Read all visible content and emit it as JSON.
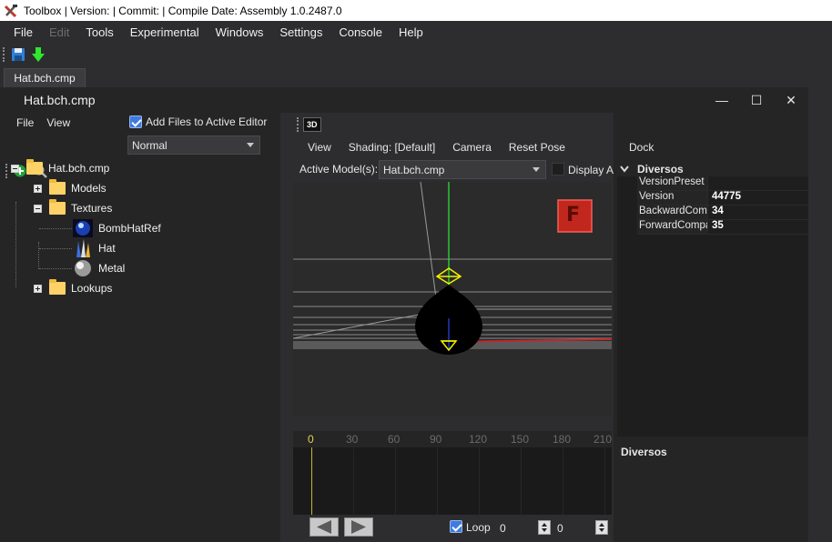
{
  "window": {
    "title": "Toolbox | Version:  | Commit:  | Compile Date:  Assembly 1.0.2487.0"
  },
  "menubar": {
    "items": [
      {
        "label": "File",
        "enabled": true
      },
      {
        "label": "Edit",
        "enabled": false
      },
      {
        "label": "Tools",
        "enabled": true
      },
      {
        "label": "Experimental",
        "enabled": true
      },
      {
        "label": "Windows",
        "enabled": true
      },
      {
        "label": "Settings",
        "enabled": true
      },
      {
        "label": "Console",
        "enabled": true
      },
      {
        "label": "Help",
        "enabled": true
      }
    ]
  },
  "toolbar": {
    "icons": [
      "save-icon",
      "download-icon"
    ]
  },
  "doc_tabs": [
    {
      "label": "Hat.bch.cmp",
      "active": true
    }
  ],
  "editor": {
    "title": "Hat.bch.cmp",
    "controls": {
      "minimize": "—",
      "maximize": "☐",
      "close": "✕"
    }
  },
  "left_panel": {
    "menu": [
      "File",
      "View"
    ],
    "add_files_label": "Add Files to Active Editor",
    "add_files_checked": true,
    "mode_select": "Normal",
    "tree": {
      "root": "Hat.bch.cmp",
      "models": "Models",
      "textures": "Textures",
      "texture_items": [
        "BombHatRef",
        "Hat",
        "Metal"
      ],
      "lookups": "Lookups"
    }
  },
  "viewport": {
    "badge": "3D",
    "menu": [
      "View",
      "Shading: [Default]",
      "Camera",
      "Reset Pose"
    ],
    "active_model_label": "Active Model(s):",
    "active_model_value": "Hat.bch.cmp",
    "display_all_label": "Display Al",
    "overlay_letter": "F",
    "timeline_ticks": [
      "0",
      "30",
      "60",
      "90",
      "120",
      "150",
      "180",
      "210"
    ],
    "loop_label": "Loop",
    "loop_checked": true,
    "frame_value": "0",
    "frame_end_value": "0"
  },
  "dock": {
    "title": "Dock",
    "category": "Diversos",
    "properties": [
      {
        "name": "VersionPreset",
        "value": ""
      },
      {
        "name": "Version",
        "value": "44775"
      },
      {
        "name": "BackwardCompa",
        "value": "34"
      },
      {
        "name": "ForwardCompati",
        "value": "35"
      }
    ],
    "description_title": "Diversos"
  },
  "colors": {
    "accent": "#3d7be0",
    "background": "#2d2d30",
    "panel": "#252526",
    "timeline_cursor": "#c9b536",
    "overlay_red": "#c1271d"
  }
}
